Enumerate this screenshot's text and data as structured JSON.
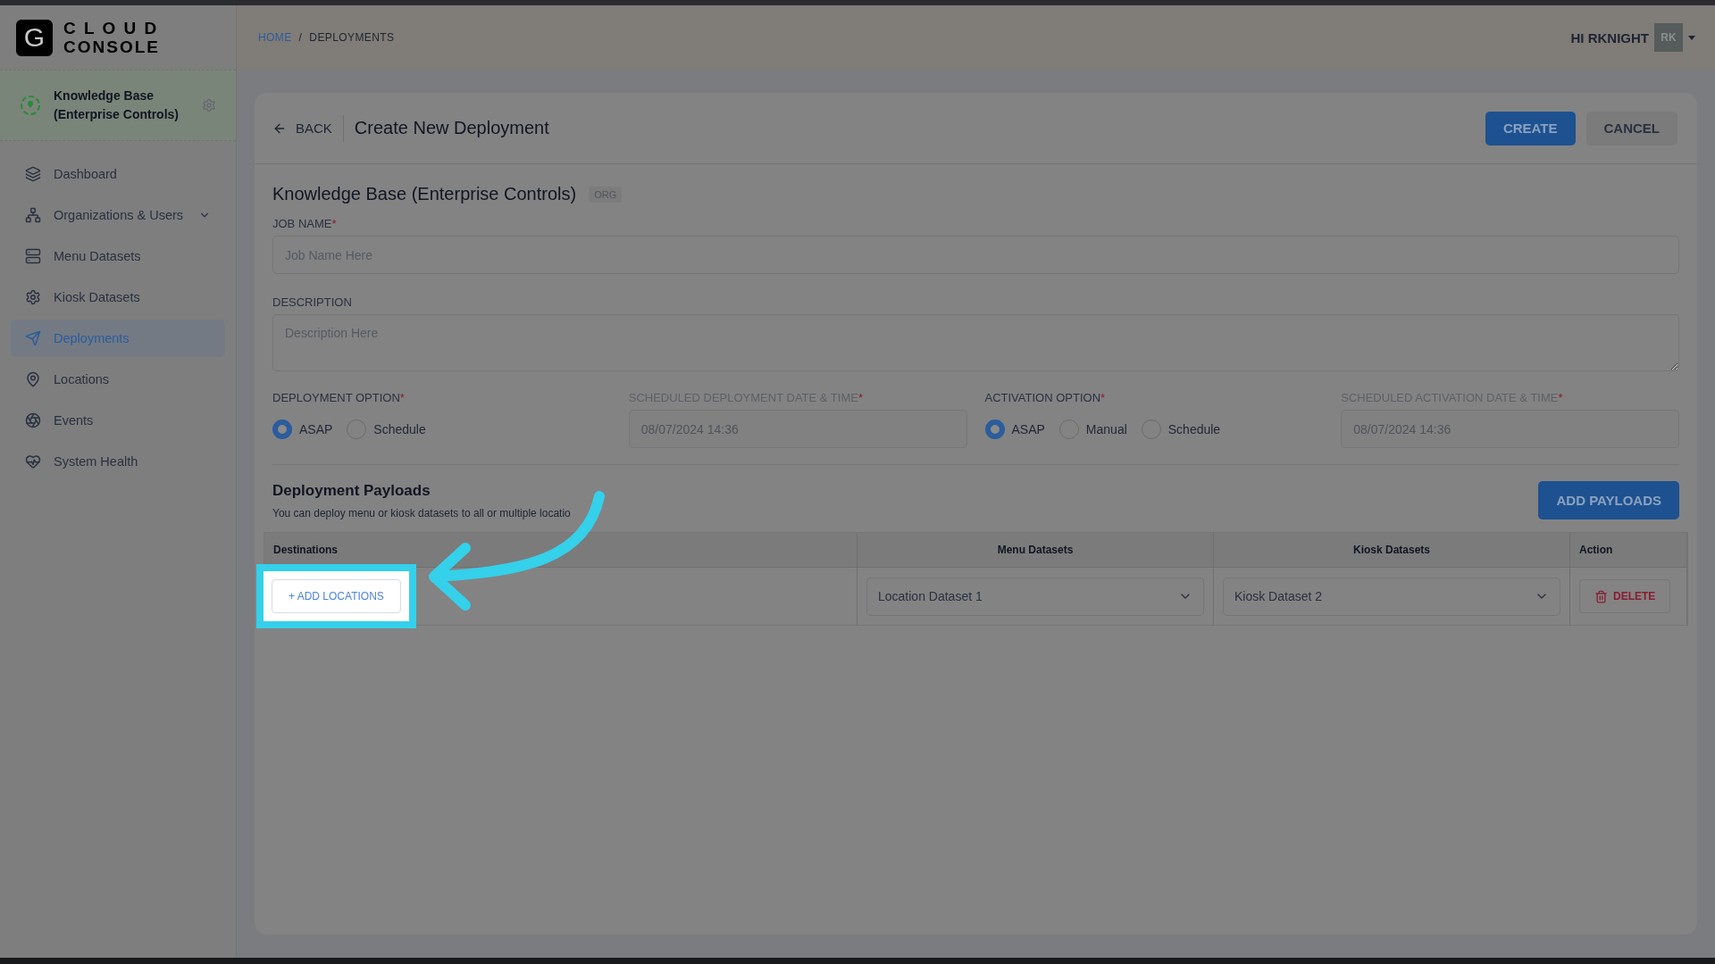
{
  "brand": {
    "mark": "G",
    "line1": "C L O U D",
    "line2": "CONSOLE"
  },
  "org_switcher": {
    "name": "Knowledge Base (Enterprise Controls)"
  },
  "sidebar": {
    "items": [
      {
        "label": "Dashboard",
        "selected": false
      },
      {
        "label": "Organizations & Users",
        "selected": false,
        "expanded": false
      },
      {
        "label": "Menu Datasets",
        "selected": false
      },
      {
        "label": "Kiosk Datasets",
        "selected": false
      },
      {
        "label": "Deployments",
        "selected": true
      },
      {
        "label": "Locations",
        "selected": false
      },
      {
        "label": "Events",
        "selected": false
      },
      {
        "label": "System Health",
        "selected": false
      }
    ]
  },
  "breadcrumb": {
    "separator": "/",
    "items": [
      {
        "label": "HOME",
        "link": true
      },
      {
        "label": "DEPLOYMENTS",
        "link": false
      }
    ]
  },
  "user": {
    "greeting": "HI RKNIGHT",
    "initials": "RK"
  },
  "header": {
    "back": "BACK",
    "title": "Create New Deployment",
    "buttons": [
      {
        "label": "CREATE",
        "kind": "primary"
      },
      {
        "label": "CANCEL",
        "kind": "secondary"
      }
    ]
  },
  "org": {
    "name": "Knowledge Base (Enterprise Controls)",
    "badge": "ORG"
  },
  "job_name": {
    "label": "JOB NAME",
    "required_mark": "*",
    "placeholder": "Job Name Here"
  },
  "description": {
    "label": "DESCRIPTION",
    "placeholder": "Description Here"
  },
  "options": [
    {
      "kind": "radio",
      "label": "DEPLOYMENT OPTION",
      "required_mark": "*",
      "choices": [
        {
          "label": "ASAP",
          "selected": true
        },
        {
          "label": "Schedule",
          "selected": false
        }
      ]
    },
    {
      "kind": "date",
      "label": "SCHEDULED DEPLOYMENT DATE & TIME",
      "required_mark": "*",
      "disabled": true,
      "value": "08/07/2024 14:36"
    },
    {
      "kind": "radio",
      "label": "ACTIVATION OPTION",
      "required_mark": "*",
      "choices": [
        {
          "label": "ASAP",
          "selected": true
        },
        {
          "label": "Manual",
          "selected": false
        },
        {
          "label": "Schedule",
          "selected": false
        }
      ]
    },
    {
      "kind": "date",
      "label": "SCHEDULED ACTIVATION DATE & TIME",
      "required_mark": "*",
      "disabled": true,
      "value": "08/07/2024 14:36"
    }
  ],
  "payloads": {
    "title": "Deployment Payloads",
    "subtitle": "You can deploy menu or kiosk datasets to all or multiple locatio",
    "add_button": "ADD PAYLOADS",
    "columns": [
      "Destinations",
      "Menu Datasets",
      "Kiosk Datasets",
      "Action"
    ],
    "rows": [
      {
        "add_locations": "+ ADD LOCATIONS",
        "highlighted": true,
        "menu_dataset": "Location Dataset 1",
        "kiosk_dataset": "Kiosk Dataset 2",
        "delete": "DELETE"
      }
    ]
  }
}
